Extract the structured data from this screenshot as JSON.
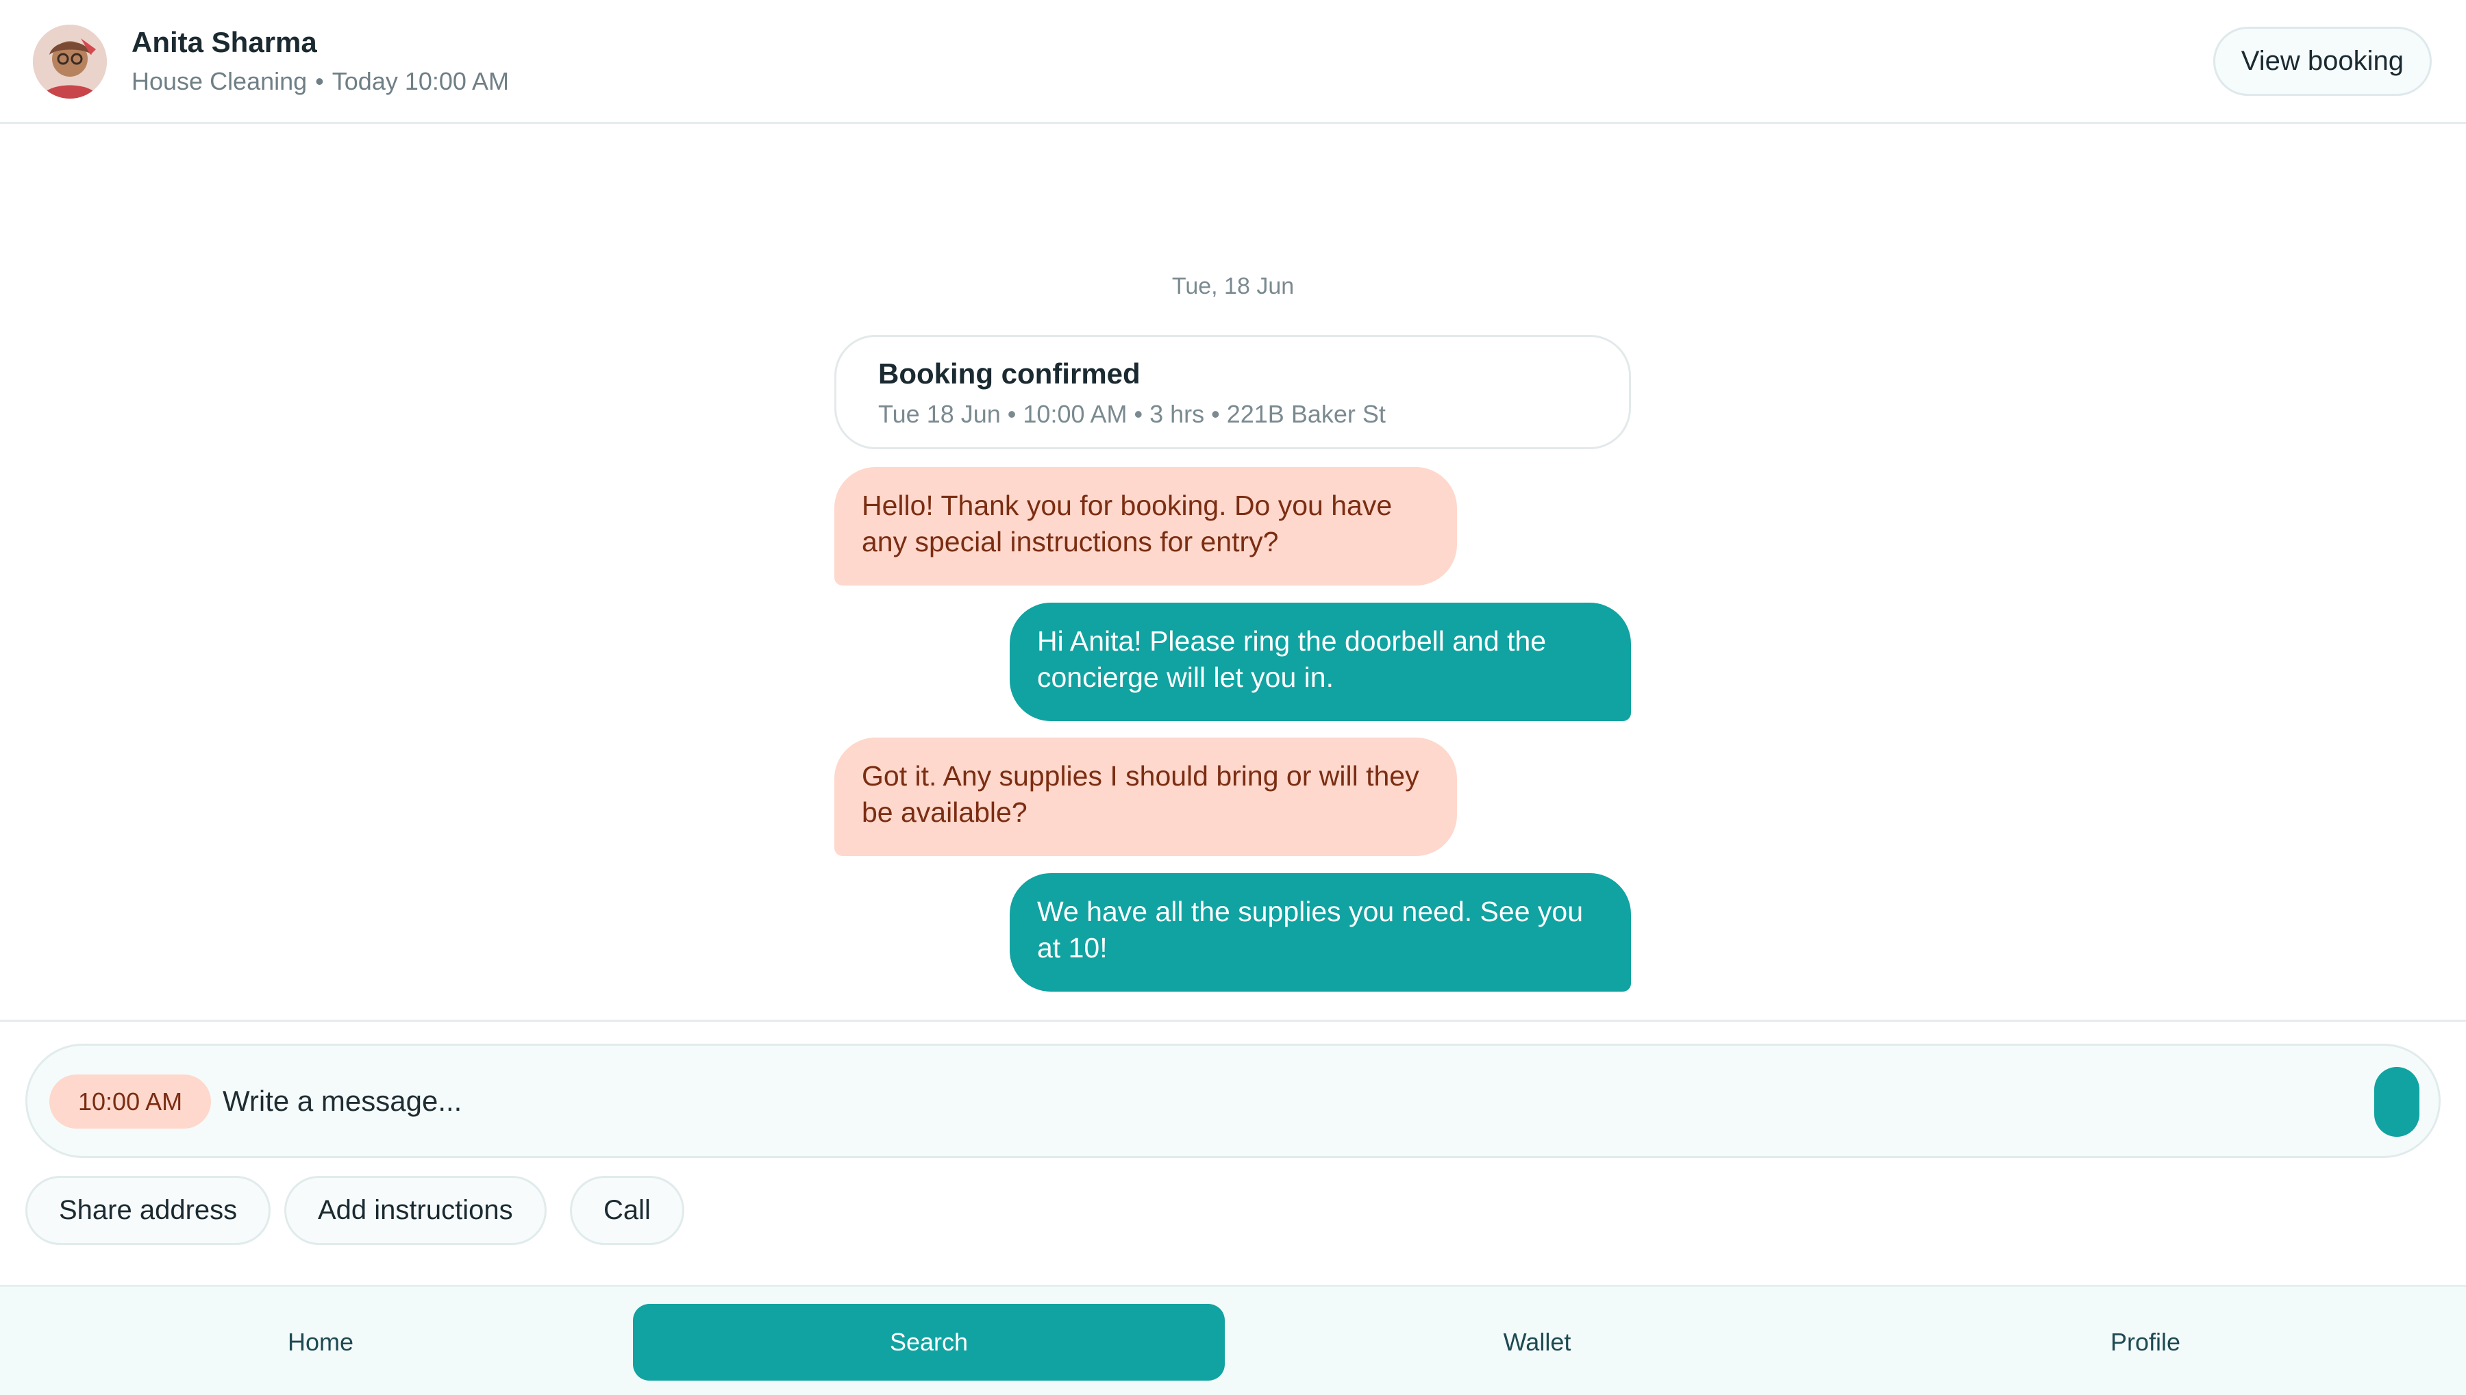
{
  "header": {
    "contact_name": "Anita Sharma",
    "service": "House Cleaning",
    "separator": "•",
    "schedule": "Today 10:00 AM",
    "view_booking_label": "View booking"
  },
  "thread": {
    "date_separator": "Tue, 18 Jun",
    "booking_card": {
      "title": "Booking confirmed",
      "details": "Tue 18 Jun • 10:00 AM • 3 hrs • 221B Baker St"
    },
    "messages": [
      {
        "direction": "incoming",
        "text": "Hello! Thank you for booking. Do you have any special instructions for entry?"
      },
      {
        "direction": "outgoing",
        "text": "Hi Anita! Please ring the doorbell and the concierge will let you in."
      },
      {
        "direction": "incoming",
        "text": "Got it. Any supplies I should bring or will they be available?"
      },
      {
        "direction": "outgoing",
        "text": "We have all the supplies you need. See you at 10!"
      }
    ]
  },
  "composer": {
    "time_chip": "10:00 AM",
    "placeholder": "Write a message...",
    "value": "",
    "quick_replies": [
      "Share address",
      "Add instructions",
      "Call"
    ]
  },
  "nav": {
    "items": [
      "Home",
      "Search",
      "Wallet",
      "Profile"
    ],
    "active": "Search"
  },
  "colors": {
    "accent": "#10a3a1",
    "incoming_bubble": "#fed8cc",
    "incoming_text": "#7b2d12",
    "nav_background": "#f3fafa"
  },
  "icons": {
    "avatar": "contact-photo",
    "send": "send-button-icon"
  }
}
